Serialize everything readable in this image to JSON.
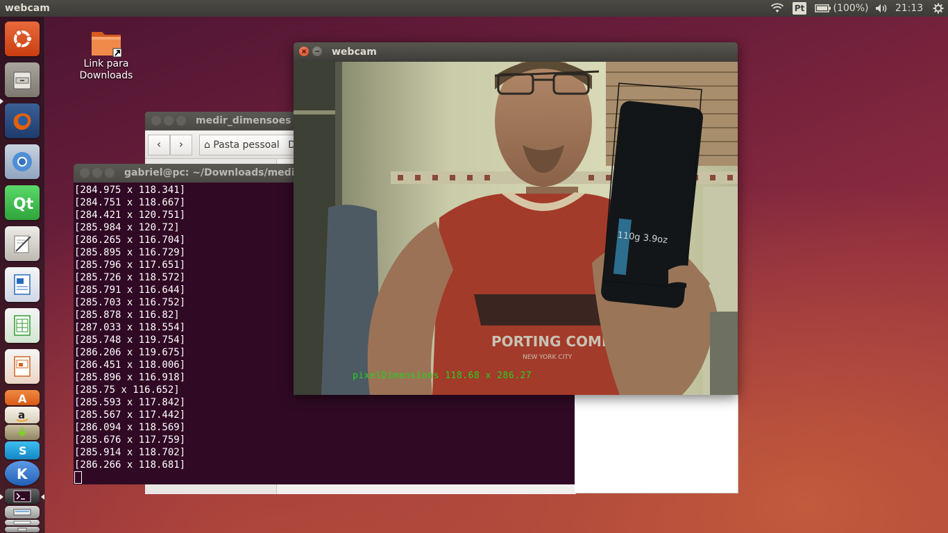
{
  "top_panel": {
    "app_title": "webcam",
    "keyboard_layout": "Pt",
    "battery_text": "(100%)",
    "clock": "21:13",
    "icons": [
      "wifi-icon",
      "battery-icon",
      "volume-icon",
      "gear-icon"
    ]
  },
  "launcher": {
    "items": [
      {
        "name": "dash-home",
        "icon": "ubuntu-logo-icon",
        "color": "#dd4814"
      },
      {
        "name": "files",
        "icon": "file-cabinet-icon",
        "color": "#8f8b84"
      },
      {
        "name": "firefox",
        "icon": "firefox-icon",
        "color": "#e66000"
      },
      {
        "name": "chromium",
        "icon": "chromium-icon",
        "color": "#4f8fd6"
      },
      {
        "name": "qt-creator",
        "icon": "qt-icon",
        "color": "#41cd52"
      },
      {
        "name": "text-editor",
        "icon": "pen-paper-icon",
        "color": "#d9d6cf"
      },
      {
        "name": "libreoffice-writer",
        "icon": "writer-icon",
        "color": "#2a6bbf"
      },
      {
        "name": "libreoffice-calc",
        "icon": "calc-icon",
        "color": "#2f9a2f"
      },
      {
        "name": "libreoffice-impress",
        "icon": "impress-icon",
        "color": "#d0651f"
      },
      {
        "name": "software-center",
        "icon": "software-center-icon",
        "color": "#e2631f"
      },
      {
        "name": "amazon",
        "icon": "amazon-icon",
        "color": "#f0a030"
      },
      {
        "name": "software-updater",
        "icon": "updater-icon",
        "color": "#d0c040"
      },
      {
        "name": "skype",
        "icon": "skype-icon",
        "color": "#1aa8e0"
      },
      {
        "name": "k-app",
        "icon": "k-icon",
        "color": "#3a7bd5"
      },
      {
        "name": "terminal",
        "icon": "terminal-icon",
        "color": "#3a3a3a"
      },
      {
        "name": "scanner",
        "icon": "scanner-icon",
        "color": "#b8b8b8"
      },
      {
        "name": "printer",
        "icon": "printer-icon",
        "color": "#cfcfcf"
      },
      {
        "name": "trash",
        "icon": "trash-icon",
        "color": "#9c9c9c"
      }
    ]
  },
  "desktop": {
    "icon_label": "Link para Downloads",
    "icon": "folder-link-icon"
  },
  "file_manager": {
    "title": "medir_dimensoes",
    "path_button": "Pasta pessoal",
    "path_next": "D"
  },
  "terminal": {
    "title": "gabriel@pc: ~/Downloads/medir_dimensoes",
    "lines": [
      "[284.975 x 118.341]",
      "[284.751 x 118.667]",
      "[284.421 x 120.751]",
      "[285.984 x 120.72]",
      "[286.265 x 116.704]",
      "[285.895 x 116.729]",
      "[285.796 x 117.651]",
      "[285.726 x 118.572]",
      "[285.791 x 116.644]",
      "[285.703 x 116.752]",
      "[285.878 x 116.82]",
      "[287.033 x 118.554]",
      "[285.748 x 119.754]",
      "[286.206 x 119.675]",
      "[286.451 x 118.006]",
      "[285.896 x 116.918]",
      "[285.75 x 116.652]",
      "[285.593 x 117.842]",
      "[285.567 x 117.442]",
      "[286.094 x 118.569]",
      "[285.676 x 117.759]",
      "[285.914 x 118.702]",
      "[286.266 x 118.681]"
    ]
  },
  "webcam": {
    "title": "webcam",
    "readout": "pixelDimensions 118.68 x 286.27",
    "shirt_text": "PORTING COMPA",
    "shirt_subtext": "NEW YORK CITY",
    "bottle_text": "110g 3.9oz"
  }
}
